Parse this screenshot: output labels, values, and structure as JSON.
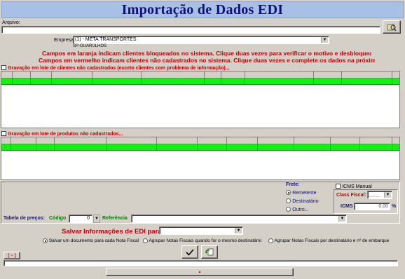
{
  "header": {
    "title": "Importação de Dados EDI"
  },
  "arquivo": {
    "label": "Arquivo:",
    "value": ""
  },
  "empresa": {
    "label": "Empresa:",
    "value": "(1) - META TRANSPORTES",
    "sub": "SP-GUARULHOS"
  },
  "warnings": {
    "line1": "Campos em laranja indicam clientes bloqueados no sistema. Clique duas vezes para verificar o motivo e desbloquear.",
    "line2": "Campos em vermelho indicam clientes não cadastrados no sistema. Clique duas vezes e complete os dados na próxima tela."
  },
  "clientes": {
    "label": "Gravação em lote de clientes não cadastrados (exceto clientes com problema de informação)...",
    "checked": false
  },
  "produtos": {
    "label": "Gravação em lote de produtos não cadastrados...",
    "checked": false
  },
  "frete": {
    "label": "Frete:",
    "options": [
      "Remetente",
      "Destinatário",
      "Outro..."
    ],
    "selected": "Remetente"
  },
  "icms": {
    "manual_label": "ICMS Manual",
    "manual_checked": false,
    "class_fiscal_label": "Class Fiscal:",
    "class_fiscal_value": "__.__",
    "icms_label": "ICMS",
    "icms_value": "0,00",
    "percent": "%"
  },
  "tabela": {
    "label": "Tabela de preços:",
    "codigo_label": "Código",
    "codigo_value": "0",
    "referencia_label": "Referência",
    "referencia_value": ""
  },
  "salvar": {
    "label": "Salvar Informações de EDI para:",
    "value": "",
    "options": [
      "Salvar um documento para cada Nota Fiscal",
      "Agrupar Notas Fiscais quando for o mesmo destinatário",
      "Agrupar Notas Fiscais por destinatário e nº de embarque"
    ],
    "selected": "Salvar um documento para cada Nota Fiscal"
  },
  "bottom": {
    "toggle_label": "[ -- ]",
    "expand_glyph": "▲"
  },
  "colors": {
    "title_bg": "#a9c0e6",
    "title_text": "#10107a",
    "warn": "#c00000",
    "grid_row": "#14f014",
    "green_label": "#007a00"
  }
}
